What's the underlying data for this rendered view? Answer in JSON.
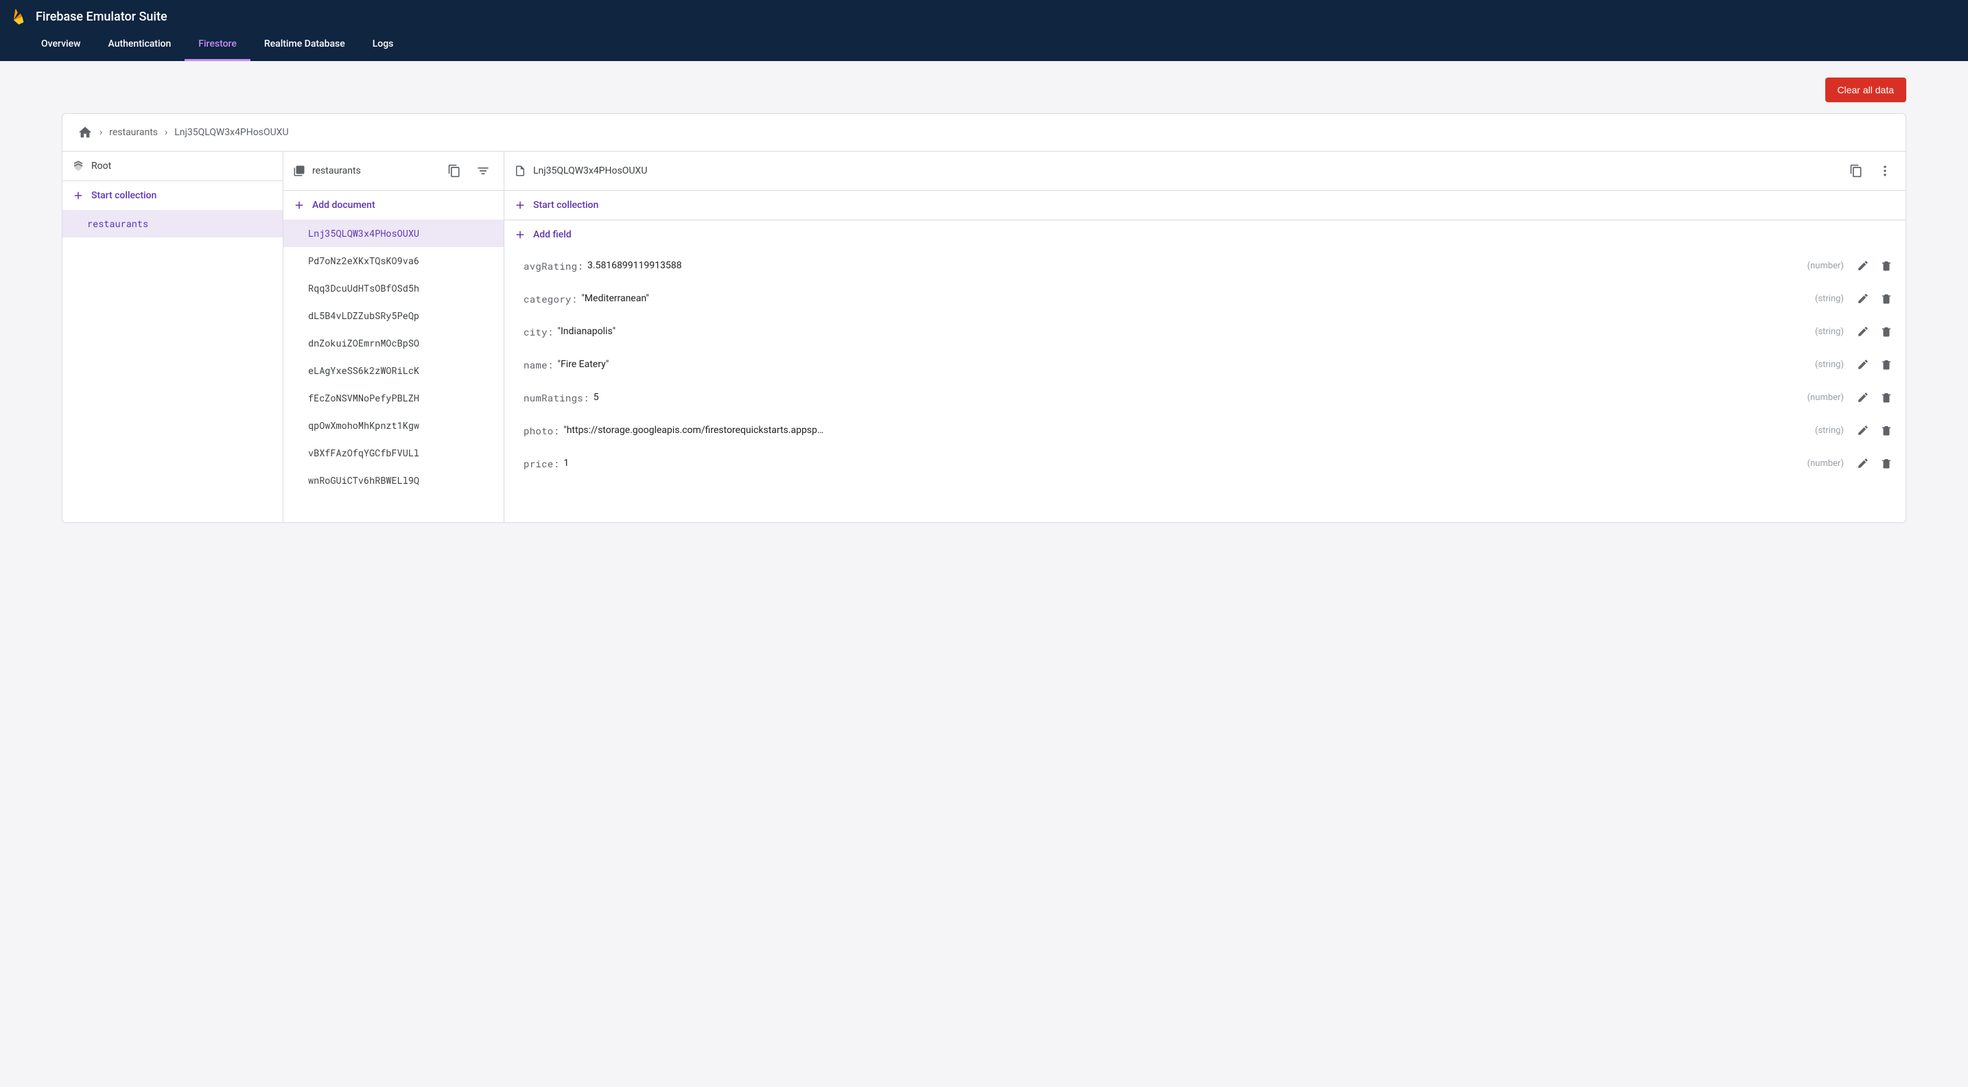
{
  "header": {
    "title": "Firebase Emulator Suite",
    "tabs": [
      {
        "label": "Overview",
        "active": false
      },
      {
        "label": "Authentication",
        "active": false
      },
      {
        "label": "Firestore",
        "active": true
      },
      {
        "label": "Realtime Database",
        "active": false
      },
      {
        "label": "Logs",
        "active": false
      }
    ]
  },
  "toolbar": {
    "clear_label": "Clear all data"
  },
  "breadcrumb": {
    "items": [
      "restaurants",
      "Lnj35QLQW3x4PHosOUXU"
    ]
  },
  "col_root": {
    "title": "Root",
    "start_collection_label": "Start collection",
    "items": [
      {
        "id": "restaurants",
        "selected": true
      }
    ]
  },
  "col_docs": {
    "title": "restaurants",
    "add_document_label": "Add document",
    "items": [
      {
        "id": "Lnj35QLQW3x4PHosOUXU",
        "selected": true
      },
      {
        "id": "Pd7oNz2eXKxTQsKO9va6",
        "selected": false
      },
      {
        "id": "Rqq3DcuUdHTsOBfOSd5h",
        "selected": false
      },
      {
        "id": "dL5B4vLDZZubSRy5PeQp",
        "selected": false
      },
      {
        "id": "dnZokuiZOEmrnMOcBpSO",
        "selected": false
      },
      {
        "id": "eLAgYxeSS6k2zWORiLcK",
        "selected": false
      },
      {
        "id": "fEcZoNSVMNoPefyPBLZH",
        "selected": false
      },
      {
        "id": "qpOwXmohoMhKpnzt1Kgw",
        "selected": false
      },
      {
        "id": "vBXfFAzOfqYGCfbFVULl",
        "selected": false
      },
      {
        "id": "wnRoGUiCTv6hRBWELl9Q",
        "selected": false
      }
    ]
  },
  "col_fields": {
    "title": "Lnj35QLQW3x4PHosOUXU",
    "start_collection_label": "Start collection",
    "add_field_label": "Add field",
    "fields": [
      {
        "key": "avgRating",
        "value": "3.5816899119913588",
        "type": "(number)",
        "quoted": false
      },
      {
        "key": "category",
        "value": "Mediterranean",
        "type": "(string)",
        "quoted": true
      },
      {
        "key": "city",
        "value": "Indianapolis",
        "type": "(string)",
        "quoted": true
      },
      {
        "key": "name",
        "value": "Fire Eatery",
        "type": "(string)",
        "quoted": true
      },
      {
        "key": "numRatings",
        "value": "5",
        "type": "(number)",
        "quoted": false
      },
      {
        "key": "photo",
        "value": "https://storage.googleapis.com/firestorequickstarts.appspot.…",
        "type": "(string)",
        "quoted": true
      },
      {
        "key": "price",
        "value": "1",
        "type": "(number)",
        "quoted": false
      }
    ]
  }
}
